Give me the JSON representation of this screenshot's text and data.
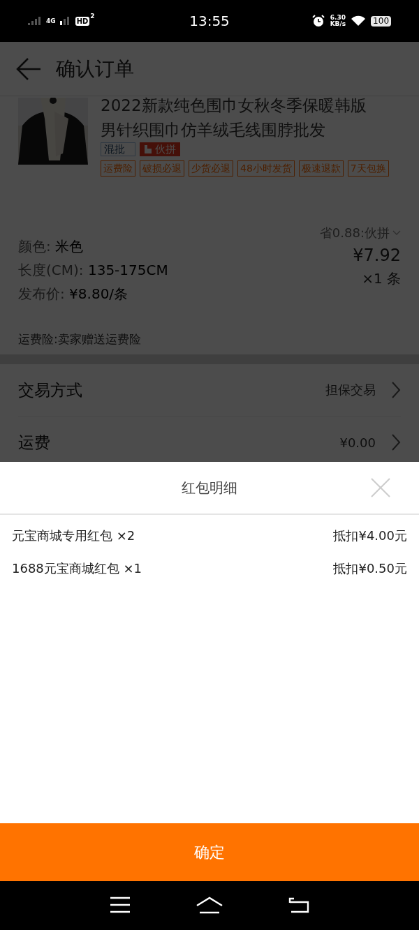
{
  "status_bar": {
    "network": "4G",
    "hd": "HD",
    "sim": "2",
    "time": "13:55",
    "speed": "6.30",
    "speed_unit": "KB/s",
    "battery": "100"
  },
  "header": {
    "title": "确认订单"
  },
  "product": {
    "title_lines": [
      "2022新款纯色围巾女秋冬季保暖韩版",
      "男针织围巾仿羊绒毛线围脖批发"
    ],
    "badges": [
      {
        "kind": "mixed",
        "label": "混批"
      },
      {
        "kind": "group",
        "label": "伙拼"
      }
    ],
    "tags": [
      "运费险",
      "破损必退",
      "少货必退",
      "48小时发货",
      "极速退款",
      "7天包换"
    ],
    "specs": [
      {
        "label": "颜色:",
        "value": "米色"
      },
      {
        "label": "长度(CM):",
        "value": "135-175CM"
      },
      {
        "label": "发布价:",
        "value": "¥8.80/条"
      }
    ],
    "discount": "省0.88:伙拼",
    "price": "¥7.92",
    "quantity": "×1 条",
    "insurance_note": "运费险:卖家赠送运费险"
  },
  "rows": [
    {
      "label": "交易方式",
      "value": "担保交易"
    },
    {
      "label": "运费",
      "value": "¥0.00"
    }
  ],
  "sheet": {
    "title": "红包明细",
    "items": [
      {
        "name": "元宝商城专用红包 ×2",
        "amount": "抵扣¥4.00元"
      },
      {
        "name": "1688元宝商城红包 ×1",
        "amount": "抵扣¥0.50元"
      }
    ]
  },
  "confirm_button": "确定"
}
